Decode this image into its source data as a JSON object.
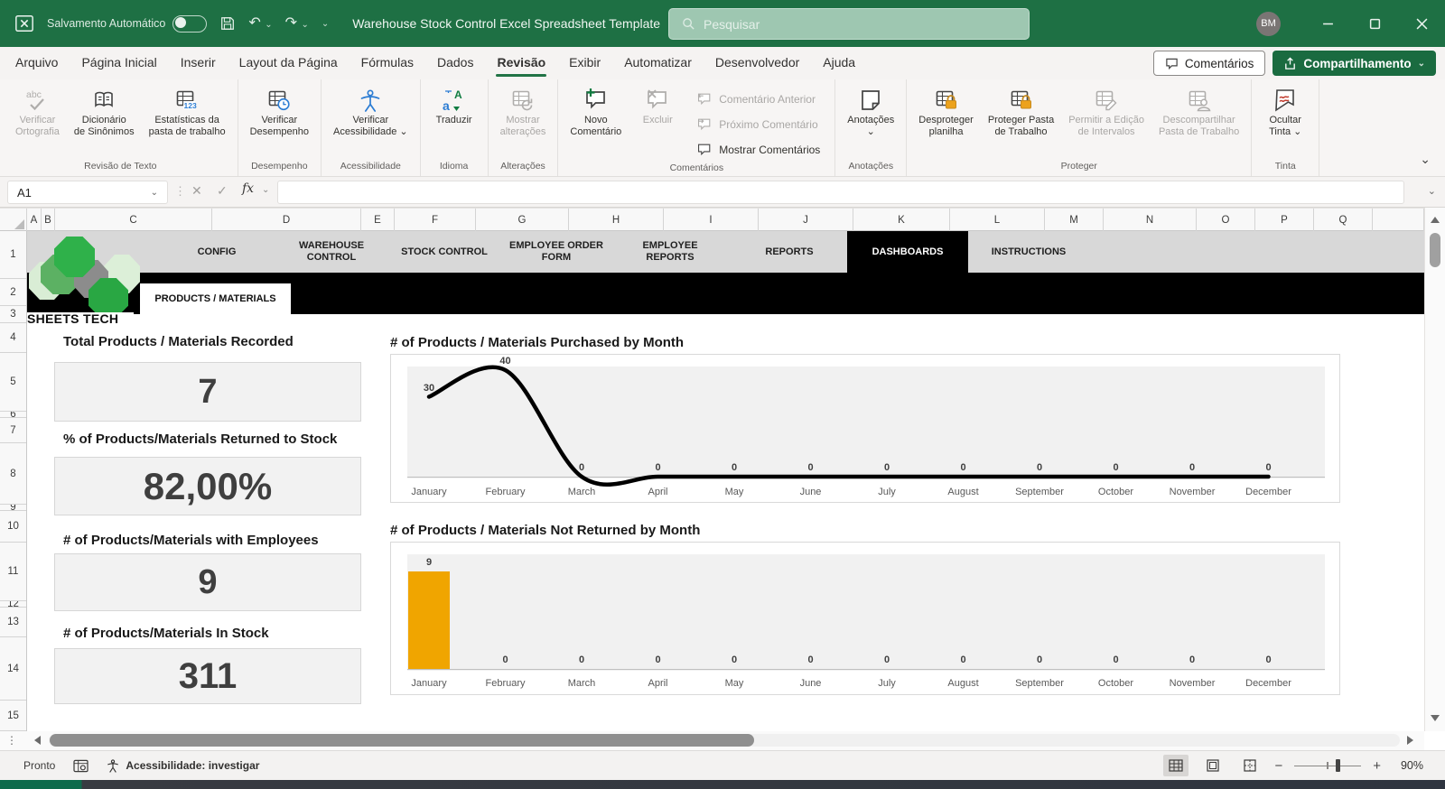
{
  "titlebar": {
    "autosave_label": "Salvamento Automático",
    "doc_title": "Warehouse Stock Control Excel Spreadsheet Template",
    "search_placeholder": "Pesquisar",
    "avatar_initials": "BM"
  },
  "menubar": {
    "tabs": [
      "Arquivo",
      "Página Inicial",
      "Inserir",
      "Layout da Página",
      "Fórmulas",
      "Dados",
      "Revisão",
      "Exibir",
      "Automatizar",
      "Desenvolvedor",
      "Ajuda"
    ],
    "active_tab": "Revisão",
    "comments_button": "Comentários",
    "share_button": "Compartilhamento"
  },
  "ribbon": {
    "groups": [
      {
        "label": "Revisão de Texto",
        "buttons": [
          {
            "label": "Verificar Ortografia",
            "lines": [
              "Verificar",
              "Ortografia"
            ],
            "icon": "spellcheck-icon",
            "disabled": true
          },
          {
            "label": "Dicionário de Sinônimos",
            "lines": [
              "Dicionário",
              "de Sinônimos"
            ],
            "icon": "thesaurus-icon"
          },
          {
            "label": "Estatísticas da pasta de trabalho",
            "lines": [
              "Estatísticas da",
              "pasta de trabalho"
            ],
            "icon": "workbook-stats-icon"
          }
        ]
      },
      {
        "label": "Desempenho",
        "buttons": [
          {
            "label": "Verificar Desempenho",
            "lines": [
              "Verificar",
              "Desempenho"
            ],
            "icon": "performance-icon"
          }
        ]
      },
      {
        "label": "Acessibilidade",
        "buttons": [
          {
            "label": "Verificar Acessibilidade",
            "lines": [
              "Verificar",
              "Acessibilidade"
            ],
            "icon": "accessibility-icon",
            "dropdown": true
          }
        ]
      },
      {
        "label": "Idioma",
        "buttons": [
          {
            "label": "Traduzir",
            "lines": [
              "Traduzir"
            ],
            "icon": "translate-icon"
          }
        ]
      },
      {
        "label": "Alterações",
        "buttons": [
          {
            "label": "Mostrar alterações",
            "lines": [
              "Mostrar",
              "alterações"
            ],
            "icon": "show-changes-icon",
            "disabled": true
          }
        ]
      },
      {
        "label": "Comentários",
        "buttons": [
          {
            "label": "Novo Comentário",
            "lines": [
              "Novo",
              "Comentário"
            ],
            "icon": "new-comment-icon"
          },
          {
            "label": "Excluir",
            "lines": [
              "Excluir"
            ],
            "icon": "delete-comment-icon",
            "disabled": true
          },
          {
            "label": "Comentário Anterior",
            "icon": "previous-comment-icon",
            "disabled": true,
            "small": true
          },
          {
            "label": "Próximo Comentário",
            "icon": "next-comment-icon",
            "disabled": true,
            "small": true
          },
          {
            "label": "Mostrar Comentários",
            "icon": "show-comments-icon",
            "small": true
          }
        ]
      },
      {
        "label": "Anotações",
        "buttons": [
          {
            "label": "Anotações",
            "lines": [
              "Anotações"
            ],
            "icon": "notes-icon",
            "dropdown": true
          }
        ]
      },
      {
        "label": "Proteger",
        "buttons": [
          {
            "label": "Desproteger planilha",
            "lines": [
              "Desproteger",
              "planilha"
            ],
            "icon": "unprotect-sheet-icon"
          },
          {
            "label": "Proteger Pasta de Trabalho",
            "lines": [
              "Proteger Pasta",
              "de Trabalho"
            ],
            "icon": "protect-workbook-icon"
          },
          {
            "label": "Permitir a Edição de Intervalos",
            "lines": [
              "Permitir a Edição",
              "de Intervalos"
            ],
            "icon": "allow-edit-ranges-icon",
            "disabled": true
          },
          {
            "label": "Descompartilhar Pasta de Trabalho",
            "lines": [
              "Descompartilhar",
              "Pasta de Trabalho"
            ],
            "icon": "unshare-workbook-icon",
            "disabled": true
          }
        ]
      },
      {
        "label": "Tinta",
        "buttons": [
          {
            "label": "Ocultar Tinta",
            "lines": [
              "Ocultar",
              "Tinta"
            ],
            "icon": "hide-ink-icon",
            "dropdown": true
          }
        ]
      }
    ]
  },
  "formula_bar": {
    "name_box": "A1",
    "fx_label": "fx",
    "formula": ""
  },
  "grid": {
    "columns": [
      "A",
      "B",
      "C",
      "D",
      "E",
      "F",
      "G",
      "H",
      "I",
      "J",
      "K",
      "L",
      "M",
      "N",
      "O",
      "P",
      "Q"
    ],
    "rows": [
      "1",
      "2",
      "3",
      "4",
      "5",
      "6",
      "7",
      "8",
      "9",
      "10",
      "11",
      "12",
      "13",
      "14",
      "15"
    ]
  },
  "sheet": {
    "logo_text": "SHEETS TECH",
    "nav_tabs": [
      "CONFIG",
      "WAREHOUSE CONTROL",
      "STOCK CONTROL",
      "EMPLOYEE ORDER FORM",
      "EMPLOYEE REPORTS",
      "REPORTS",
      "DASHBOARDS",
      "INSTRUCTIONS"
    ],
    "active_nav_tab": "DASHBOARDS",
    "sub_tab": "PRODUCTS / MATERIALS",
    "kpis": [
      {
        "label": "Total Products / Materials Recorded",
        "value": "7"
      },
      {
        "label": "% of Products/Materials Returned to Stock",
        "value": "82,00%"
      },
      {
        "label": "# of Products/Materials with Employees",
        "value": "9"
      },
      {
        "label": "# of Products/Materials In Stock",
        "value": "311"
      }
    ]
  },
  "chart_data": [
    {
      "type": "line",
      "title": "# of Products / Materials Purchased by Month",
      "categories": [
        "January",
        "February",
        "March",
        "April",
        "May",
        "June",
        "July",
        "August",
        "September",
        "October",
        "November",
        "December"
      ],
      "values": [
        30,
        40,
        0,
        0,
        0,
        0,
        0,
        0,
        0,
        0,
        0,
        0
      ],
      "ylim": [
        0,
        40
      ],
      "line_color": "#000000",
      "plot_bg": "#F1F1F1",
      "data_labels": true,
      "grid": false,
      "legend": "none"
    },
    {
      "type": "bar",
      "title": "# of Products / Materials Not Returned by Month",
      "categories": [
        "January",
        "February",
        "March",
        "April",
        "May",
        "June",
        "July",
        "August",
        "September",
        "October",
        "November",
        "December"
      ],
      "values": [
        9,
        0,
        0,
        0,
        0,
        0,
        0,
        0,
        0,
        0,
        0,
        0
      ],
      "ylim": [
        0,
        10
      ],
      "bar_color": "#F0A500",
      "plot_bg": "#F1F1F1",
      "data_labels": true,
      "grid": false,
      "legend": "none"
    }
  ],
  "statusbar": {
    "ready": "Pronto",
    "accessibility": "Acessibilidade: investigar",
    "zoom_out": "−",
    "zoom_in": "+",
    "zoom_level": "90%"
  },
  "colors": {
    "titlebar_green": "#1E7044",
    "accent_green": "#217346",
    "share_green": "#1A6B40",
    "bar_orange": "#F0A500",
    "band_gray": "#D8D8D8",
    "card_bg": "#F2F2F2"
  }
}
